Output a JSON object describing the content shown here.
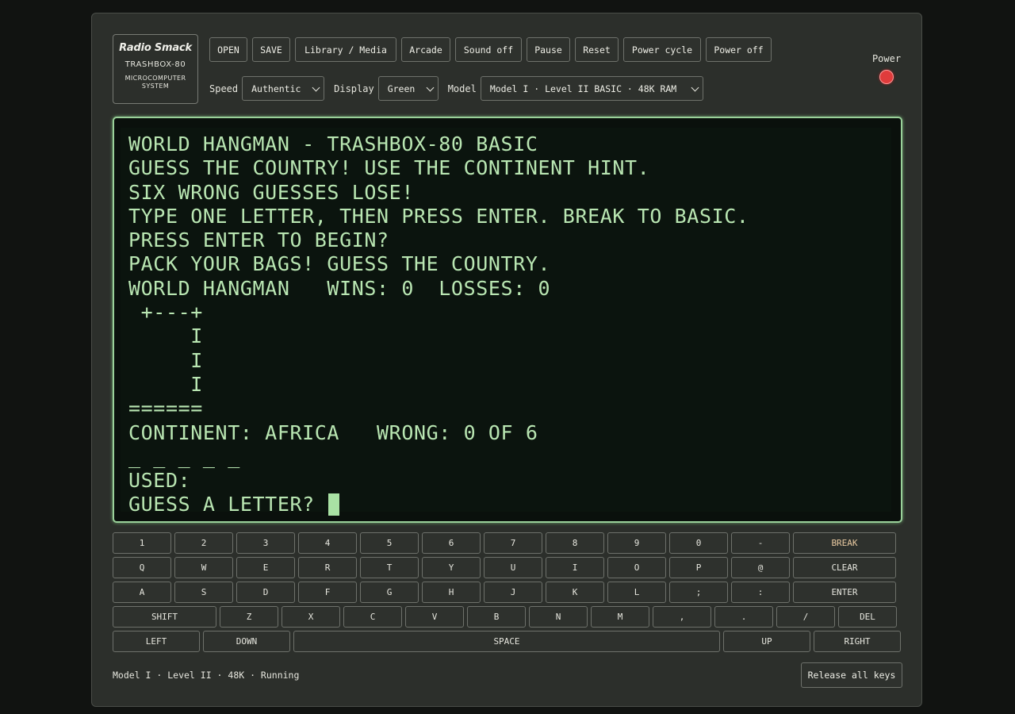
{
  "logo": {
    "brand": "Radio Smack",
    "model": "TRASHBOX-80",
    "system_line1": "MICROCOMPUTER",
    "system_line2": "SYSTEM"
  },
  "toolbar": {
    "open": "OPEN",
    "save": "SAVE",
    "library": "Library / Media",
    "arcade": "Arcade",
    "sound": "Sound off",
    "pause": "Pause",
    "reset": "Reset",
    "power_cycle": "Power cycle",
    "power_off": "Power off"
  },
  "controls": {
    "speed_label": "Speed",
    "speed_value": "Authentic",
    "display_label": "Display",
    "display_value": "Green",
    "model_label": "Model",
    "model_value": "Model I · Level II BASIC · 48K RAM"
  },
  "power": {
    "label": "Power",
    "led_color": "#e03c3c"
  },
  "screen": {
    "lines": [
      "WORLD HANGMAN - TRASHBOX-80 BASIC",
      "GUESS THE COUNTRY! USE THE CONTINENT HINT.",
      "SIX WRONG GUESSES LOSE!",
      "TYPE ONE LETTER, THEN PRESS ENTER. BREAK TO BASIC.",
      "PRESS ENTER TO BEGIN?",
      "PACK YOUR BAGS! GUESS THE COUNTRY.",
      "WORLD HANGMAN   WINS: 0  LOSSES: 0",
      " +---+",
      "     I",
      "     I",
      "     I",
      "======",
      "CONTINENT: AFRICA   WRONG: 0 OF 6",
      "_ _ _ _ _",
      "USED:",
      "GUESS A LETTER? "
    ],
    "phosphor_color": "#b9e6b2"
  },
  "keyboard": {
    "row1": [
      "1",
      "2",
      "3",
      "4",
      "5",
      "6",
      "7",
      "8",
      "9",
      "0",
      "-",
      "BREAK"
    ],
    "row2": [
      "Q",
      "W",
      "E",
      "R",
      "T",
      "Y",
      "U",
      "I",
      "O",
      "P",
      "@",
      "CLEAR"
    ],
    "row3": [
      "A",
      "S",
      "D",
      "F",
      "G",
      "H",
      "J",
      "K",
      "L",
      ";",
      ":",
      "ENTER"
    ],
    "row4": [
      "SHIFT",
      "Z",
      "X",
      "C",
      "V",
      "B",
      "N",
      "M",
      ",",
      ".",
      "/",
      "DEL"
    ],
    "row5": [
      "LEFT",
      "DOWN",
      "SPACE",
      "UP",
      "RIGHT"
    ]
  },
  "status": {
    "text": "Model I · Level II · 48K · Running",
    "release_label": "Release all keys"
  }
}
